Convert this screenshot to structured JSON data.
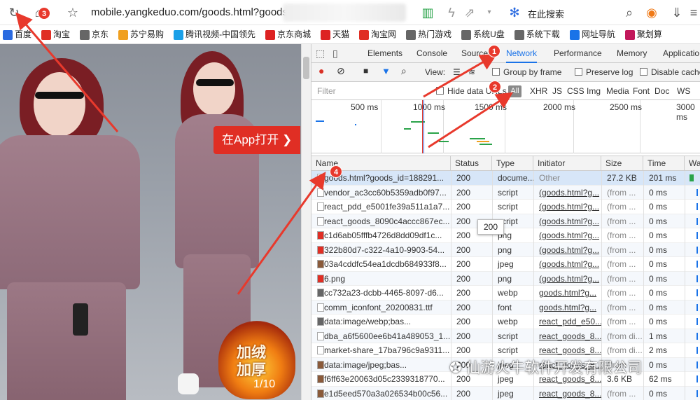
{
  "address": {
    "url": "mobile.yangkeduo.com/goods.html?goods",
    "search_label": "在此搜索"
  },
  "bookmarks": [
    "百度",
    "淘宝",
    "京东",
    "苏宁易购",
    "腾讯视频-中国领先",
    "京东商城",
    "天猫",
    "淘宝网",
    "热门游戏",
    "系统U盘",
    "系统下载",
    "网址导航",
    "聚划算"
  ],
  "product": {
    "open_app": "在App打开",
    "flame_text": "加绒加厚",
    "counter": "1/10"
  },
  "devtools": {
    "tabs": [
      "Elements",
      "Console",
      "Sources",
      "Network",
      "Performance",
      "Memory",
      "Applicatio"
    ],
    "active_tab": "Network",
    "toolbar": {
      "view": "View:",
      "group_by_frame": "Group by frame",
      "preserve_log": "Preserve log",
      "disable_cache": "Disable cache"
    },
    "filter": {
      "placeholder": "Filter",
      "hide_data_urls": "Hide data URLs",
      "all": "All",
      "types": [
        "XHR",
        "JS",
        "CSS",
        "Img",
        "Media",
        "Font",
        "Doc",
        "WS"
      ]
    },
    "timeline": [
      "500 ms",
      "1000 ms",
      "1500 ms",
      "2000 ms",
      "2500 ms",
      "3000 ms"
    ],
    "columns": [
      "Name",
      "Status",
      "Type",
      "Initiator",
      "Size",
      "Time",
      "Wat"
    ],
    "rows": [
      {
        "name": "goods.html?goods_id=188291...",
        "status": "200",
        "type": "docume...",
        "initiator": "Other",
        "size": "27.2 KB",
        "time": "201 ms"
      },
      {
        "name": "vendor_ac3cc60b5359adb0f97...",
        "status": "200",
        "type": "script",
        "initiator": "(goods.html?g...",
        "size": "(from ...",
        "time": "0 ms"
      },
      {
        "name": "react_pdd_e5001fe39a511a1a7...",
        "status": "200",
        "type": "script",
        "initiator": "(goods.html?g...",
        "size": "(from ...",
        "time": "0 ms"
      },
      {
        "name": "react_goods_8090c4accc867ec...",
        "status": "200",
        "type": "script",
        "initiator": "(goods.html?g...",
        "size": "(from ...",
        "time": "0 ms"
      },
      {
        "name": "c1d6ab05fffb4726d8dd09df1c...",
        "status": "200",
        "type": "png",
        "initiator": "(goods.html?g...",
        "size": "(from ...",
        "time": "0 ms"
      },
      {
        "name": "322b80d7-c322-4a10-9903-54...",
        "status": "200",
        "type": "png",
        "initiator": "(goods.html?g...",
        "size": "(from ...",
        "time": "0 ms"
      },
      {
        "name": "03a4cddfc54ea1dcdb684933f8...",
        "status": "200",
        "type": "jpeg",
        "initiator": "(goods.html?g...",
        "size": "(from ...",
        "time": "0 ms"
      },
      {
        "name": "6.png",
        "status": "200",
        "type": "png",
        "initiator": "(goods.html?g...",
        "size": "(from ...",
        "time": "0 ms"
      },
      {
        "name": "cc732a23-dcbb-4465-8097-d6...",
        "status": "200",
        "type": "webp",
        "initiator": "goods.html?g...",
        "size": "(from ...",
        "time": "0 ms"
      },
      {
        "name": "comm_iconfont_20200831.ttf",
        "status": "200",
        "type": "font",
        "initiator": "goods.html?g...",
        "size": "(from ...",
        "time": "0 ms"
      },
      {
        "name": "data:image/webp;bas...",
        "status": "200",
        "type": "webp",
        "initiator": "react_pdd_e50...",
        "size": "(from ...",
        "time": "0 ms"
      },
      {
        "name": "dba_a6f5600ee6b41a489053_1...",
        "status": "200",
        "type": "script",
        "initiator": "react_goods_8...",
        "size": "(from di...",
        "time": "1 ms"
      },
      {
        "name": "market-share_17ba796c9a9311...",
        "status": "200",
        "type": "script",
        "initiator": "react_goods_8...",
        "size": "(from di...",
        "time": "2 ms"
      },
      {
        "name": "data:image/jpeg;bas...",
        "status": "200",
        "type": "jpeg",
        "initiator": "react_goods_8...",
        "size": "(from ...",
        "time": "0 ms"
      },
      {
        "name": "f6ff63e20063d05c2339318770...",
        "status": "200",
        "type": "jpeg",
        "initiator": "react_goods_8...",
        "size": "3.6 KB",
        "time": "62 ms"
      },
      {
        "name": "e1d5eed570a3a026534b00c56...",
        "status": "200",
        "type": "jpeg",
        "initiator": "react_goods_8...",
        "size": "(from ...",
        "time": "0 ms"
      }
    ],
    "tooltip": "200"
  },
  "annotations": [
    "1",
    "2",
    "3",
    "4"
  ],
  "watermark": "仙游火牛软件开发有限公司"
}
